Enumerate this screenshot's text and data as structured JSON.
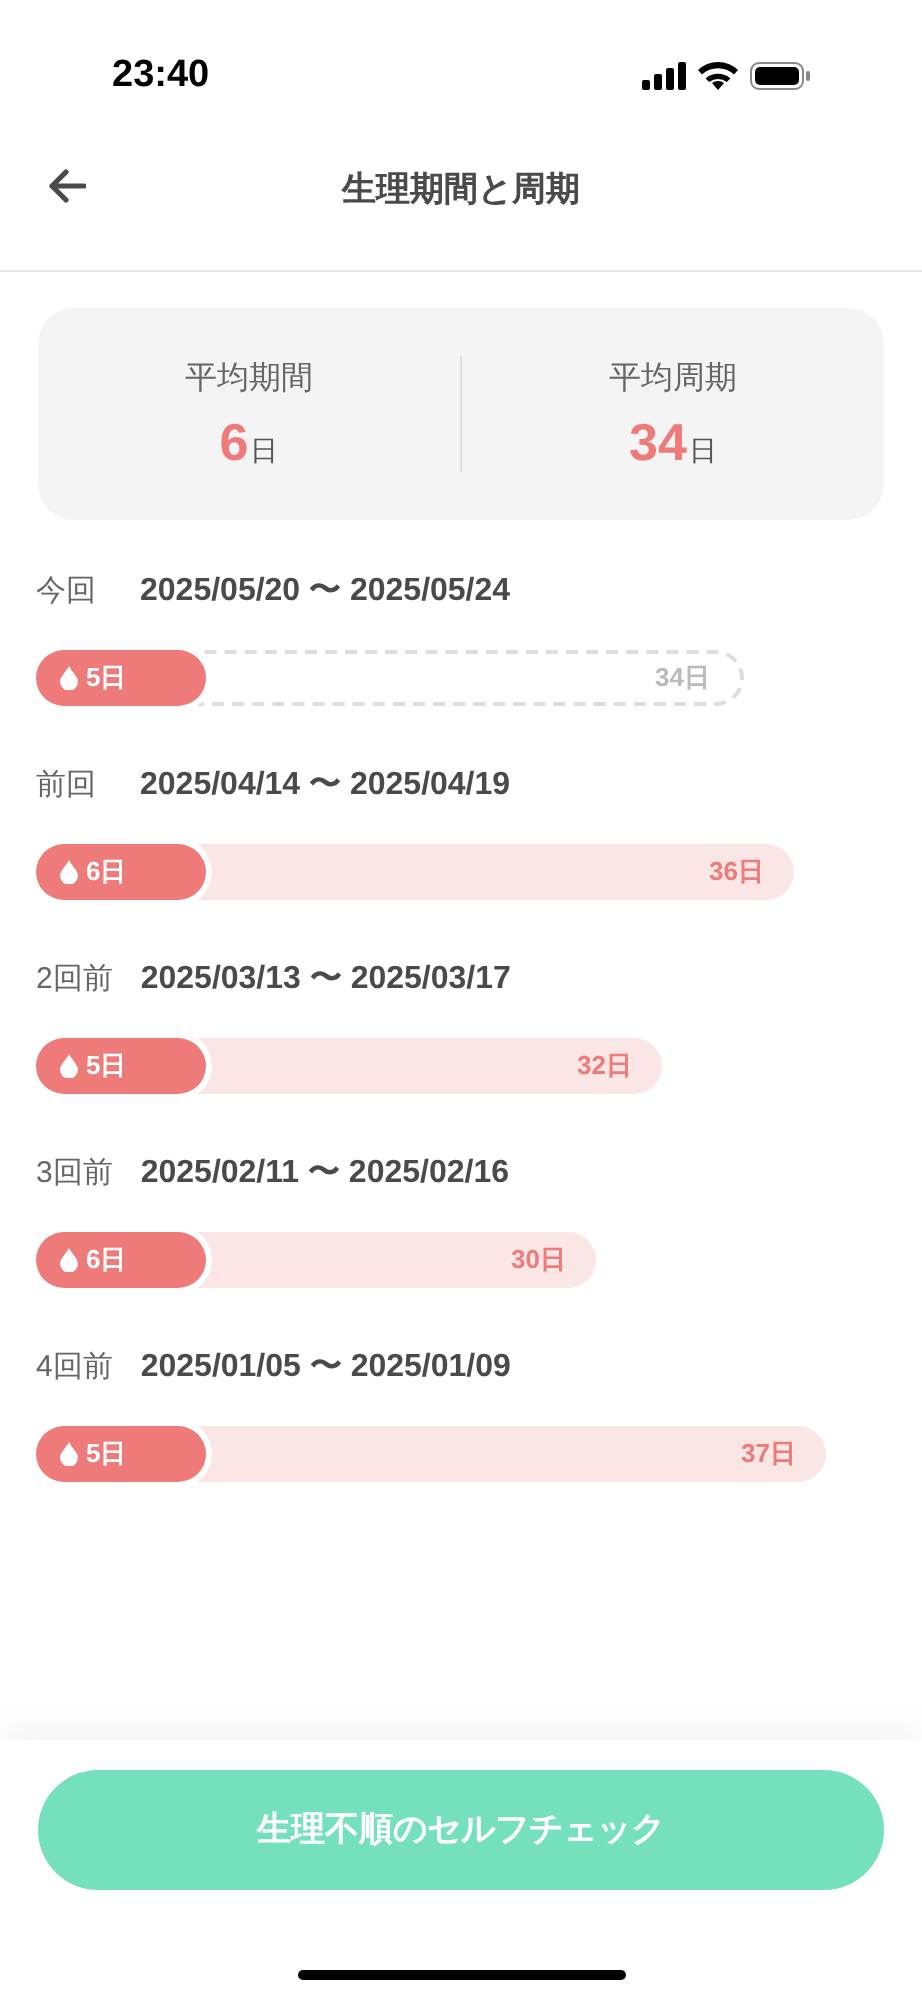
{
  "status_bar": {
    "time": "23:40"
  },
  "header": {
    "title": "生理期間と周期"
  },
  "summary": [
    {
      "label": "平均期間",
      "value": "6",
      "unit": "日"
    },
    {
      "label": "平均周期",
      "value": "34",
      "unit": "日"
    }
  ],
  "cycles": [
    {
      "label": "今回",
      "dates": "2025/05/20 〜 2025/05/24",
      "period": "5日",
      "cycle": "34日",
      "kind": "current"
    },
    {
      "label": "前回",
      "dates": "2025/04/14 〜 2025/04/19",
      "period": "6日",
      "cycle": "36日",
      "kind": "past"
    },
    {
      "label": "2回前",
      "dates": "2025/03/13 〜 2025/03/17",
      "period": "5日",
      "cycle": "32日",
      "kind": "past"
    },
    {
      "label": "3回前",
      "dates": "2025/02/11 〜 2025/02/16",
      "period": "6日",
      "cycle": "30日",
      "kind": "past"
    },
    {
      "label": "4回前",
      "dates": "2025/01/05 〜 2025/01/09",
      "period": "5日",
      "cycle": "37日",
      "kind": "past"
    }
  ],
  "footer_button": {
    "label": "生理不順のセルフチェック"
  }
}
